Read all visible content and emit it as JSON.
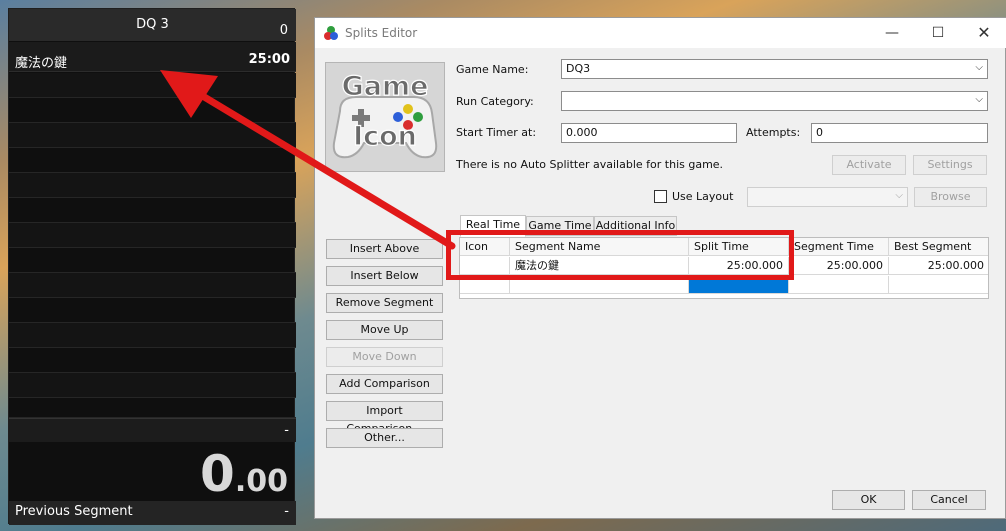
{
  "timer": {
    "game_name": "DQ 3",
    "attempts": "0",
    "segment_name": "魔法の鍵",
    "segment_time": "25:00",
    "last_split_value": "-",
    "time_main": "0",
    "time_fraction": ".00",
    "previous_segment_label": "Previous Segment",
    "previous_segment_value": "-"
  },
  "editor": {
    "title": "Splits Editor",
    "game_name_label": "Game Name:",
    "game_name_value": "DQ3",
    "run_category_label": "Run Category:",
    "run_category_value": "",
    "start_timer_label": "Start Timer at:",
    "start_timer_value": "0.000",
    "attempts_label": "Attempts:",
    "attempts_value": "0",
    "auto_splitter_text": "There is no Auto Splitter available for this game.",
    "activate_label": "Activate",
    "settings_label": "Settings",
    "use_layout_label": "Use Layout",
    "browse_label": "Browse",
    "game_icon": {
      "line1": "Game",
      "line2": "Icon"
    },
    "side_buttons": [
      "Insert Above",
      "Insert Below",
      "Remove Segment",
      "Move Up",
      "Move Down",
      "Add Comparison",
      "Import Comparison...",
      "Other..."
    ],
    "tabs": [
      "Real Time",
      "Game Time",
      "Additional Info"
    ],
    "columns": [
      "Icon",
      "Segment Name",
      "Split Time",
      "Segment Time",
      "Best Segment"
    ],
    "rows": [
      {
        "icon": "",
        "segment_name": "魔法の鍵",
        "split_time": "25:00.000",
        "segment_time": "25:00.000",
        "best_segment": "25:00.000"
      }
    ],
    "ok_label": "OK",
    "cancel_label": "Cancel"
  },
  "colors": {
    "highlight": "#e11919",
    "selection": "#0078d7"
  }
}
